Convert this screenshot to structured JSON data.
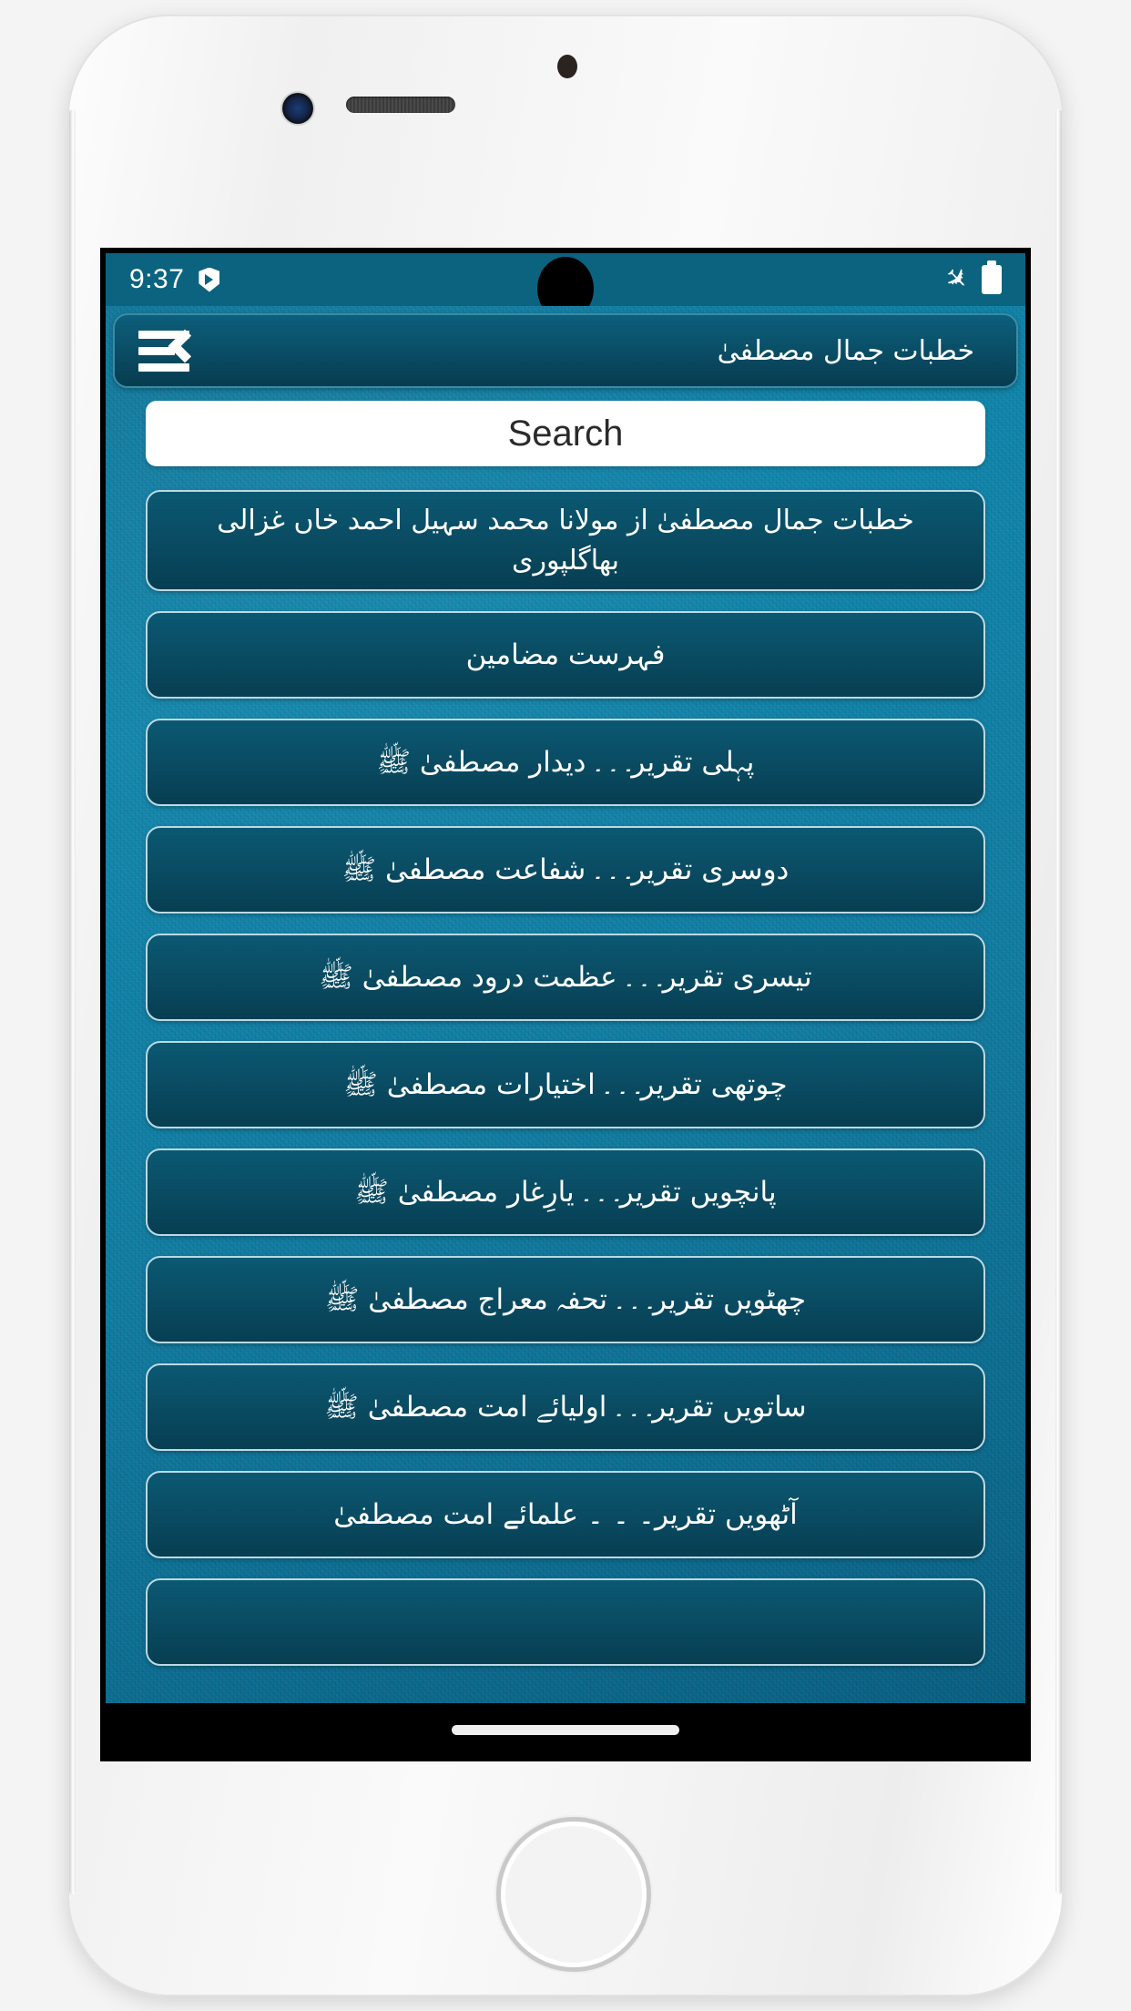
{
  "status_bar": {
    "time": "9:37",
    "left_icon": "shield-play-icon",
    "right_icons": [
      "airplane-mode-icon",
      "battery-full-icon"
    ],
    "airplane_glyph": "✈",
    "background_color": "#0b637f"
  },
  "app_bar": {
    "title": "خطبات جمال مصطفیٰ",
    "menu_icon": "drawer-menu-open-icon"
  },
  "search": {
    "value": "",
    "placeholder": "Search"
  },
  "theme": {
    "background_accent": "#1382a6",
    "card_color": "#0a4d64",
    "card_border": "#bcd9e4",
    "header_color": "#0a4a61",
    "text_color": "#ffffff"
  },
  "list": {
    "items": [
      {
        "label": "خطبات جمال مصطفیٰ از مولانا محمد سہیل احمد خاں غزالی بھاگلپوری"
      },
      {
        "label": "فہرست مضامین"
      },
      {
        "label": "پہلی تقریر۔ ۔ ۔ دیدار مصطفیٰ ﷺ"
      },
      {
        "label": "دوسری تقریر۔ ۔ ۔ شفاعت مصطفیٰ ﷺ"
      },
      {
        "label": "تیسری تقریر۔ ۔ ۔ عظمت درود مصطفیٰ ﷺ"
      },
      {
        "label": "چوتھی تقریر۔ ۔ ۔ اختیارات مصطفیٰ ﷺ"
      },
      {
        "label": "پانچویں تقریر۔ ۔ ۔ یارِغار مصطفیٰ ﷺ"
      },
      {
        "label": "چھٹویں تقریر۔ ۔ ۔ تحفہ معراج مصطفیٰ ﷺ"
      },
      {
        "label": "ساتویں تقریر۔ ۔ ۔ اولیائے امت مصطفیٰ ﷺ"
      },
      {
        "label": "آٹھویں تقریر۔ ۔ ۔ علمائے امت مصطفیٰ"
      },
      {
        "label": ""
      }
    ]
  },
  "nav_bar": {
    "home_indicator": "home-gesture-pill"
  }
}
